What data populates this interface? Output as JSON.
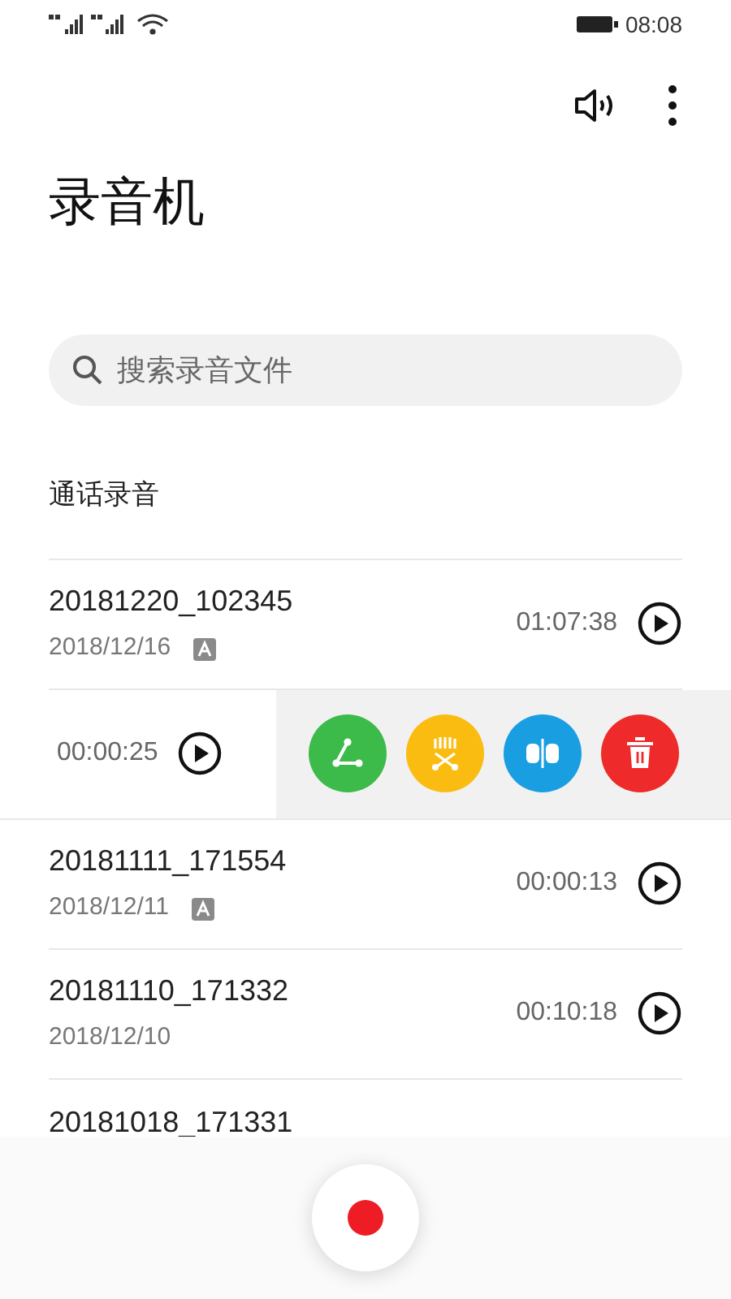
{
  "status_bar": {
    "time": "08:08"
  },
  "title": "录音机",
  "search": {
    "placeholder": "搜索录音文件"
  },
  "section": "通话录音",
  "recordings": [
    {
      "kind": "normal",
      "name": "20181220_102345",
      "date": "2018/12/16",
      "auto_badge": true,
      "duration": "01:07:38"
    },
    {
      "kind": "swiped",
      "duration": "00:00:25",
      "actions": [
        {
          "kind": "share",
          "color": "#3cba4a"
        },
        {
          "kind": "trim",
          "color": "#fbbc12"
        },
        {
          "kind": "split",
          "color": "#1a9ee2"
        },
        {
          "kind": "delete",
          "color": "#ee2a2a"
        }
      ]
    },
    {
      "kind": "normal",
      "name": "20181111_171554",
      "date": "2018/12/11",
      "auto_badge": true,
      "duration": "00:00:13"
    },
    {
      "kind": "normal",
      "name": "20181110_171332",
      "date": "2018/12/10",
      "auto_badge": false,
      "duration": "00:10:18"
    },
    {
      "kind": "partial",
      "name": "20181018_171331"
    }
  ]
}
